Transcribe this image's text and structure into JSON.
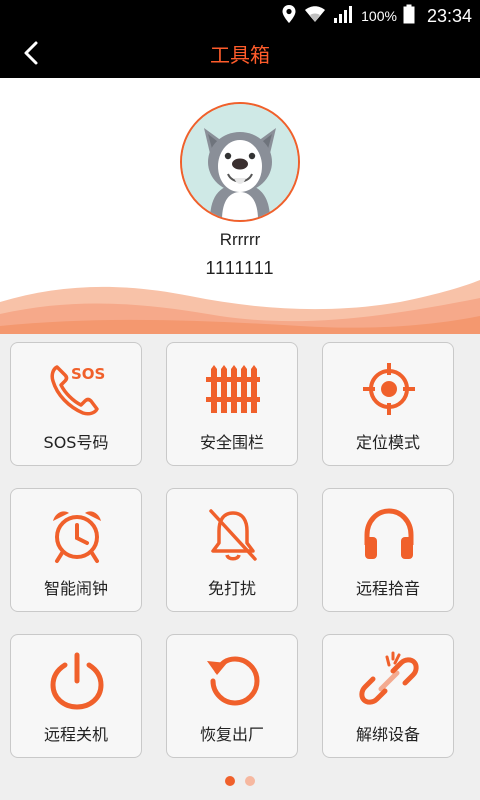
{
  "status_bar": {
    "battery": "100%",
    "time": "23:34",
    "icons": [
      "location-icon",
      "wifi-icon",
      "signal-icon",
      "battery-icon"
    ]
  },
  "app_bar": {
    "title": "工具箱",
    "back_icon": "back-arrow-icon"
  },
  "profile": {
    "name": "Rrrrrr",
    "number": "1111111",
    "avatar_icon": "dog-avatar-icon"
  },
  "tools": [
    {
      "label": "SOS号码",
      "icon": "sos-phone-icon"
    },
    {
      "label": "安全围栏",
      "icon": "fence-icon"
    },
    {
      "label": "定位模式",
      "icon": "target-icon"
    },
    {
      "label": "智能闹钟",
      "icon": "alarm-clock-icon"
    },
    {
      "label": "免打扰",
      "icon": "bell-off-icon"
    },
    {
      "label": "远程拾音",
      "icon": "headphones-icon"
    },
    {
      "label": "远程关机",
      "icon": "power-icon"
    },
    {
      "label": "恢复出厂",
      "icon": "reset-icon"
    },
    {
      "label": "解绑设备",
      "icon": "unlink-icon"
    }
  ],
  "pagination": {
    "pages": 2,
    "current": 1
  },
  "colors": {
    "accent": "#f0602b",
    "title": "#ff5c2b",
    "dot_active": "#f0602b",
    "dot_inactive": "#f6b8a0"
  }
}
